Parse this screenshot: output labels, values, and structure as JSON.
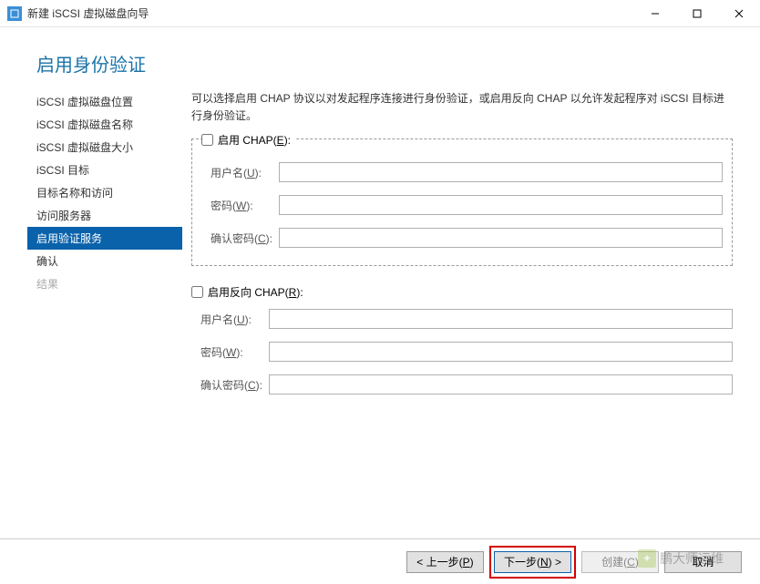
{
  "window": {
    "title": "新建 iSCSI 虚拟磁盘向导"
  },
  "header": {
    "title": "启用身份验证"
  },
  "sidebar": {
    "items": [
      {
        "label": "iSCSI 虚拟磁盘位置",
        "state": "normal"
      },
      {
        "label": "iSCSI 虚拟磁盘名称",
        "state": "normal"
      },
      {
        "label": "iSCSI 虚拟磁盘大小",
        "state": "normal"
      },
      {
        "label": "iSCSI 目标",
        "state": "normal"
      },
      {
        "label": "目标名称和访问",
        "state": "normal"
      },
      {
        "label": "访问服务器",
        "state": "normal"
      },
      {
        "label": "启用验证服务",
        "state": "active"
      },
      {
        "label": "确认",
        "state": "normal"
      },
      {
        "label": "结果",
        "state": "disabled"
      }
    ]
  },
  "content": {
    "description": "可以选择启用 CHAP 协议以对发起程序连接进行身份验证，或启用反向 CHAP 以允许发起程序对 iSCSI 目标进行身份验证。",
    "chap": {
      "title_pre": "启用 CHAP(",
      "title_key": "E",
      "title_post": "):",
      "checked": false,
      "user_pre": "用户名(",
      "user_key": "U",
      "user_post": "):",
      "user_val": "",
      "pwd_pre": "密码(",
      "pwd_key": "W",
      "pwd_post": "):",
      "pwd_val": "",
      "cpwd_pre": "确认密码(",
      "cpwd_key": "C",
      "cpwd_post": "):",
      "cpwd_val": ""
    },
    "rchap": {
      "title_pre": "启用反向 CHAP(",
      "title_key": "R",
      "title_post": "):",
      "checked": false,
      "user_pre": "用户名(",
      "user_key": "U",
      "user_post": "):",
      "user_val": "",
      "pwd_pre": "密码(",
      "pwd_key": "W",
      "pwd_post": "):",
      "pwd_val": "",
      "cpwd_pre": "确认密码(",
      "cpwd_key": "C",
      "cpwd_post": "):",
      "cpwd_val": ""
    }
  },
  "footer": {
    "prev_pre": "< 上一步(",
    "prev_key": "P",
    "prev_post": ")",
    "next_pre": "下一步(",
    "next_key": "N",
    "next_post": ") >",
    "create_pre": "创建(",
    "create_key": "C",
    "create_post": ")",
    "cancel": "取消"
  },
  "watermark": {
    "text": "鹏大师运维"
  }
}
